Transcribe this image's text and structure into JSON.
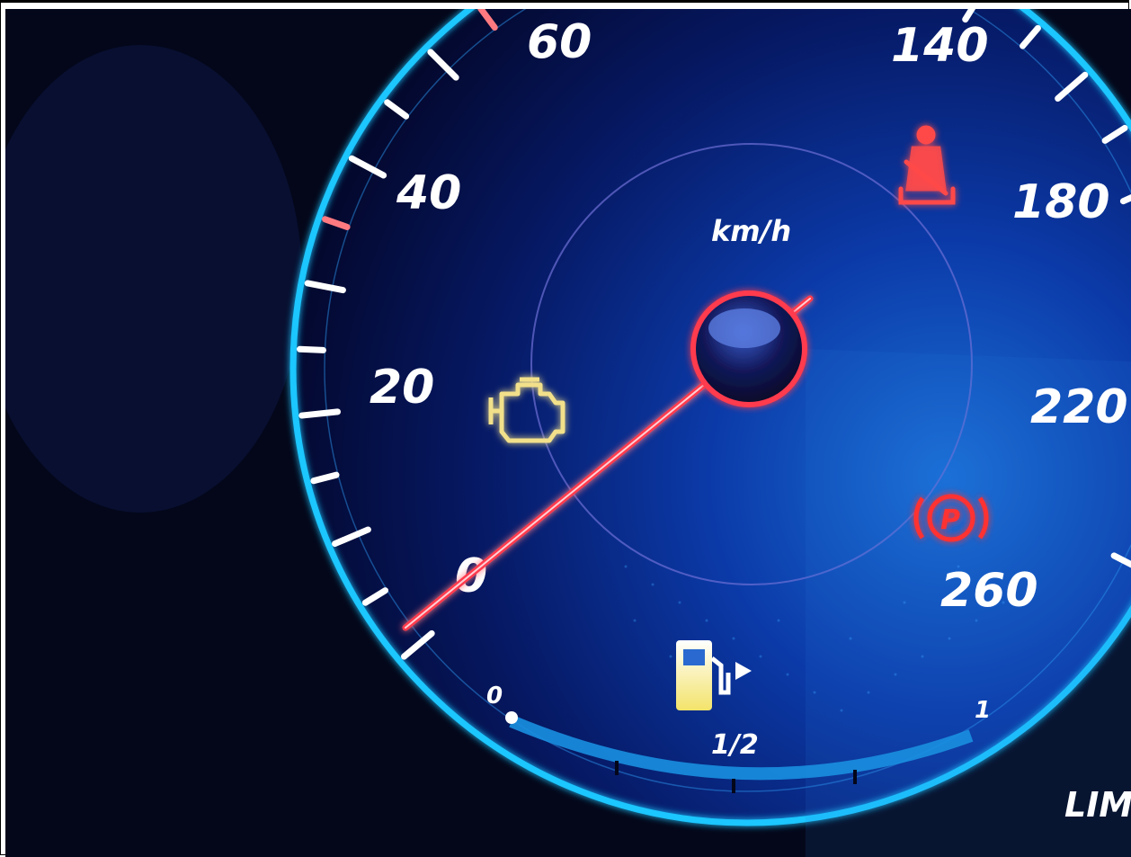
{
  "speedometer": {
    "unit": "km/h",
    "speed_labels": [
      "0",
      "20",
      "40",
      "60",
      "140",
      "180",
      "220",
      "260"
    ],
    "current_speed_kmh": 0
  },
  "fuel_gauge": {
    "labels": [
      "0",
      "1/2",
      "1"
    ],
    "level_fraction": 0.0,
    "icon": "fuel-pump-icon"
  },
  "warning_lights": [
    {
      "name": "check-engine",
      "icon": "engine-icon",
      "color": "#f2e08a"
    },
    {
      "name": "seatbelt",
      "icon": "seatbelt-icon",
      "color": "#ff4a4a"
    },
    {
      "name": "parking-brake",
      "icon": "parking-brake-icon",
      "color": "#ff3030"
    }
  ],
  "lim_label": "LIM",
  "colors": {
    "ring": "#1ec6ff",
    "needle": "#ff3b4d",
    "numerals": "#ffffff",
    "warning_red": "#ff3b3b",
    "engine_amber": "#f2e08a"
  }
}
